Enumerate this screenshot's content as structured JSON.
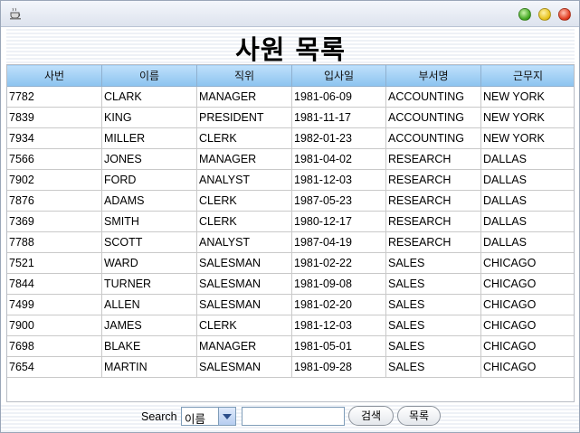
{
  "window": {
    "icon": "coffee-cup-icon",
    "controls": [
      "minimize",
      "maximize",
      "close"
    ]
  },
  "heading": "사원 목록",
  "table": {
    "columns": [
      "사번",
      "이름",
      "직위",
      "입사일",
      "부서명",
      "근무지"
    ],
    "rows": [
      [
        "7782",
        "CLARK",
        "MANAGER",
        "1981-06-09",
        "ACCOUNTING",
        "NEW YORK"
      ],
      [
        "7839",
        "KING",
        "PRESIDENT",
        "1981-11-17",
        "ACCOUNTING",
        "NEW YORK"
      ],
      [
        "7934",
        "MILLER",
        "CLERK",
        "1982-01-23",
        "ACCOUNTING",
        "NEW YORK"
      ],
      [
        "7566",
        "JONES",
        "MANAGER",
        "1981-04-02",
        "RESEARCH",
        "DALLAS"
      ],
      [
        "7902",
        "FORD",
        "ANALYST",
        "1981-12-03",
        "RESEARCH",
        "DALLAS"
      ],
      [
        "7876",
        "ADAMS",
        "CLERK",
        "1987-05-23",
        "RESEARCH",
        "DALLAS"
      ],
      [
        "7369",
        "SMITH",
        "CLERK",
        "1980-12-17",
        "RESEARCH",
        "DALLAS"
      ],
      [
        "7788",
        "SCOTT",
        "ANALYST",
        "1987-04-19",
        "RESEARCH",
        "DALLAS"
      ],
      [
        "7521",
        "WARD",
        "SALESMAN",
        "1981-02-22",
        "SALES",
        "CHICAGO"
      ],
      [
        "7844",
        "TURNER",
        "SALESMAN",
        "1981-09-08",
        "SALES",
        "CHICAGO"
      ],
      [
        "7499",
        "ALLEN",
        "SALESMAN",
        "1981-02-20",
        "SALES",
        "CHICAGO"
      ],
      [
        "7900",
        "JAMES",
        "CLERK",
        "1981-12-03",
        "SALES",
        "CHICAGO"
      ],
      [
        "7698",
        "BLAKE",
        "MANAGER",
        "1981-05-01",
        "SALES",
        "CHICAGO"
      ],
      [
        "7654",
        "MARTIN",
        "SALESMAN",
        "1981-09-28",
        "SALES",
        "CHICAGO"
      ]
    ]
  },
  "search": {
    "label": "Search",
    "field_selected": "이름",
    "query_value": "",
    "search_button": "검색",
    "list_button": "목록"
  },
  "colors": {
    "header_gradient_top": "#bfe0fb",
    "header_gradient_bottom": "#8cc3ef",
    "window_border": "#9aa6b8"
  }
}
